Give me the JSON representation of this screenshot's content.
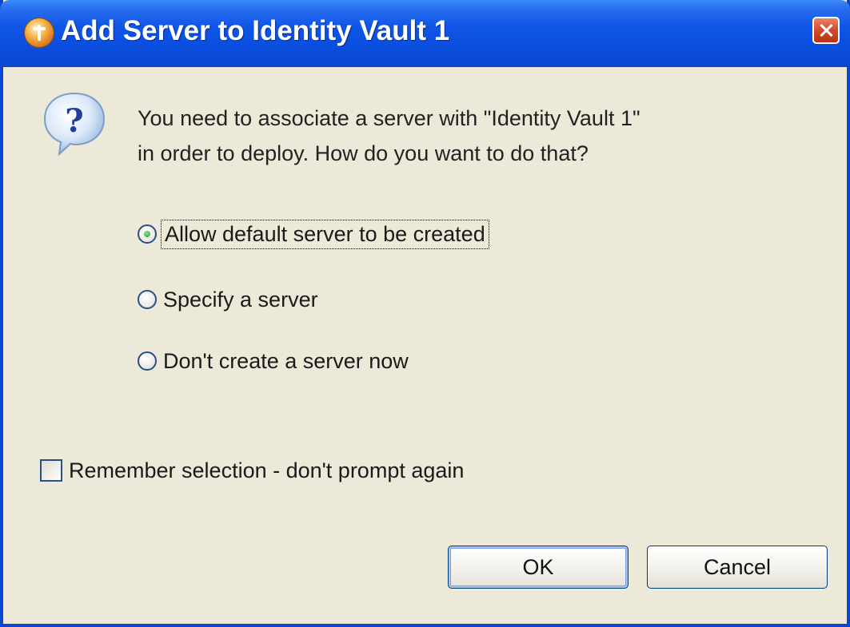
{
  "window": {
    "title": "Add Server to Identity Vault 1",
    "titlebar_color": "#0a4ede",
    "icon": "app-icon"
  },
  "message": {
    "icon": "question-icon",
    "line1": "You need to associate a server with \"Identity Vault 1\"",
    "line2": "in order to deploy.  How do you want to do that?"
  },
  "options": [
    {
      "label": "Allow default server to be created",
      "checked": true
    },
    {
      "label": "Specify a server",
      "checked": false
    },
    {
      "label": "Don't create a server now",
      "checked": false
    }
  ],
  "remember": {
    "label": "Remember selection - don't prompt again",
    "checked": false
  },
  "buttons": {
    "ok": "OK",
    "cancel": "Cancel"
  }
}
